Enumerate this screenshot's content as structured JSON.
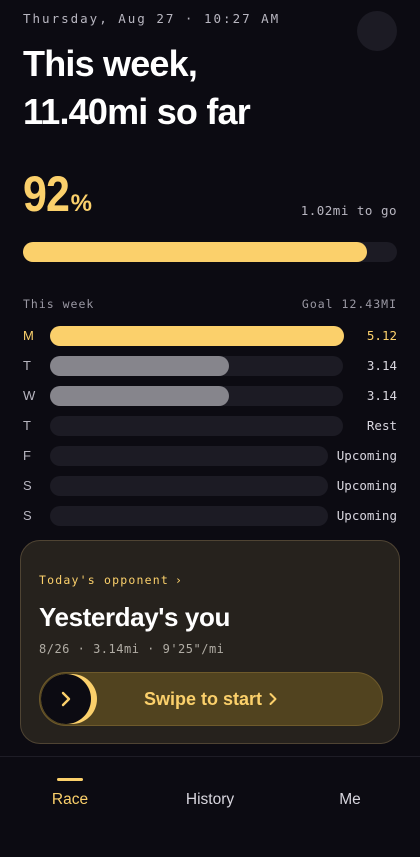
{
  "status": {
    "datetime": "Thursday, Aug 27 · 10:27 AM"
  },
  "header": {
    "line1": "This week,",
    "line2": "11.40mi so far"
  },
  "progress": {
    "percent_value": "92",
    "percent_sign": "%",
    "fraction": 0.92,
    "remaining": "1.02mi to go"
  },
  "week": {
    "title": "This week",
    "goal": "Goal 12.43MI",
    "days": [
      {
        "label": "M",
        "value": "5.12",
        "fraction": 1.0,
        "status": "today",
        "color": "#fbd06b"
      },
      {
        "label": "T",
        "value": "3.14",
        "fraction": 0.61,
        "status": "done",
        "color": "#86858c"
      },
      {
        "label": "W",
        "value": "3.14",
        "fraction": 0.61,
        "status": "done",
        "color": "#86858c"
      },
      {
        "label": "T",
        "value": "Rest",
        "fraction": 0,
        "status": "rest",
        "color": "#1c1b24"
      },
      {
        "label": "F",
        "value": "Upcoming",
        "fraction": 0,
        "status": "upcoming",
        "color": "#1c1b24"
      },
      {
        "label": "S",
        "value": "Upcoming",
        "fraction": 0,
        "status": "upcoming",
        "color": "#1c1b24"
      },
      {
        "label": "S",
        "value": "Upcoming",
        "fraction": 0,
        "status": "upcoming",
        "color": "#1c1b24"
      }
    ]
  },
  "opponent": {
    "eyebrow": "Today's opponent",
    "eyebrow_icon": "chevron-right-icon",
    "title": "Yesterday's you",
    "meta": "8/26 · 3.14mi · 9'25\"/mi",
    "swipe_label": "Swipe to start",
    "swipe_icon": "chevron-right-icon"
  },
  "tabs": [
    {
      "label": "Race",
      "active": true
    },
    {
      "label": "History",
      "active": false
    },
    {
      "label": "Me",
      "active": false
    }
  ],
  "colors": {
    "accent": "#fbd06b",
    "background": "#0c0b12",
    "track": "#1c1b24",
    "done": "#86858c"
  }
}
